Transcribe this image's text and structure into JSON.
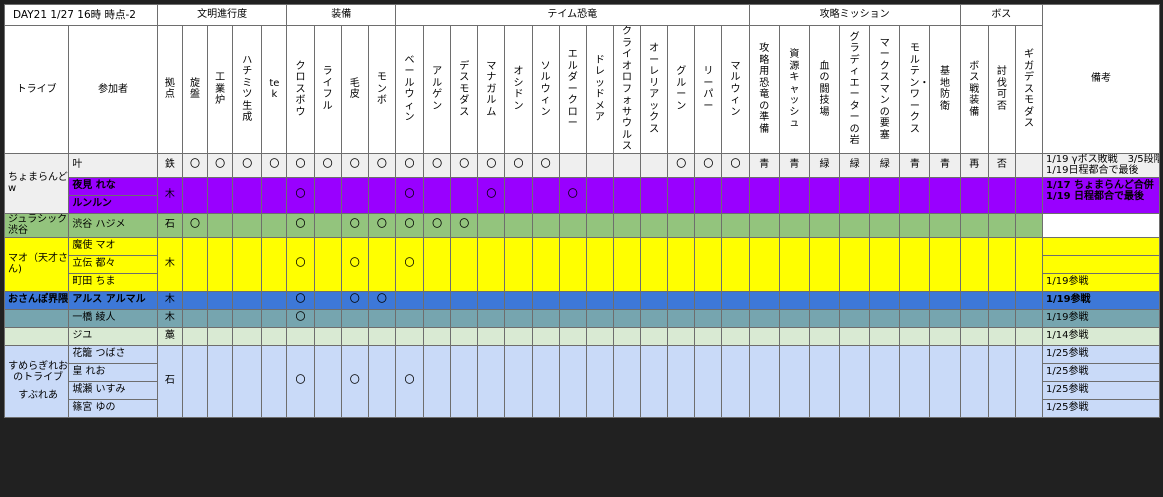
{
  "title": "DAY21 1/27 16時 時点-2",
  "groups": {
    "civ": "文明進行度",
    "equip": "装備",
    "dino": "テイム恐竜",
    "mission": "攻略ミッション",
    "boss": "ボス"
  },
  "headers": {
    "tribe": "トライブ",
    "member": "参加者",
    "note": "備考",
    "cols": [
      "拠点",
      "旋盤",
      "工業炉",
      "ハチミツ生成",
      "tek",
      "クロスボウ",
      "ライフル",
      "毛皮",
      "モンボ",
      "ベールウィン",
      "アルゲン",
      "デスモダス",
      "マナガルム",
      "オシドン",
      "ソルウィン",
      "エルダークロー",
      "ドレッドメア",
      "クライオロフォサウルス",
      "オーレリアックス",
      "グルーン",
      "リーパー",
      "マルウィン",
      "攻略用恐竜の準備",
      "資源キャッシュ",
      "血の闘技場",
      "グラディエーターの岩",
      "マークスマンの要塞",
      "モルテン・ワークス",
      "基地防衛",
      "ボス戦装備",
      "討伐可否",
      "ギガデスモダス"
    ]
  },
  "tribes": {
    "t1": "ちょまらんどw",
    "t2": "ジュラシック渋谷",
    "t3": "マオ（天才さん)",
    "t4": "おさんぽ界隈",
    "t5a": "すめらぎれおのトライブ",
    "t5b": "すぶれあ"
  },
  "rows": [
    {
      "name": "叶",
      "cells": [
        "鉄",
        "〇",
        "〇",
        "〇",
        "〇",
        "〇",
        "〇",
        "〇",
        "〇",
        "〇",
        "〇",
        "〇",
        "〇",
        "〇",
        "〇",
        "",
        "",
        "",
        "",
        "〇",
        "〇",
        "〇",
        "青",
        "青",
        "緑",
        "緑",
        "緑",
        "青",
        "青",
        "再",
        "否",
        ""
      ],
      "note": "1/19 γボス敗戦　3/5段階",
      "note2": "1/19日程都合で最後"
    },
    {
      "name": "夜見 れな",
      "cells": [
        "木",
        "",
        "",
        "",
        "",
        "〇",
        "",
        "",
        "",
        "〇",
        "",
        "",
        "〇",
        "",
        "",
        "〇",
        "",
        "",
        "",
        "",
        "",
        "",
        "",
        "",
        "",
        "",
        "",
        "",
        "",
        "",
        "",
        ""
      ],
      "note": "1/17 ちょまらんど合併",
      "note2": "1/19  日程都合で最後"
    },
    {
      "name": "ルンルン"
    },
    {
      "name": "渋谷 ハジメ",
      "cells": [
        "石",
        "〇",
        "",
        "",
        "",
        "〇",
        "",
        "〇",
        "〇",
        "〇",
        "〇",
        "〇",
        "",
        "",
        "",
        "",
        "",
        "",
        "",
        "",
        "",
        "",
        "",
        "",
        "",
        "",
        "",
        "",
        "",
        "",
        "",
        ""
      ],
      "note": ""
    },
    {
      "name": "魔使 マオ",
      "cells": [
        "木",
        "",
        "",
        "",
        "",
        "〇",
        "",
        "〇",
        "",
        "〇",
        "",
        "",
        "",
        "",
        "",
        "",
        "",
        "",
        "",
        "",
        "",
        "",
        "",
        "",
        "",
        "",
        "",
        "",
        "",
        "",
        "",
        ""
      ]
    },
    {
      "name": "立伝 都々"
    },
    {
      "name": "町田 ちま",
      "note": "1/19参戦"
    },
    {
      "name": "アルス アルマル",
      "cells": [
        "木",
        "",
        "",
        "",
        "",
        "〇",
        "",
        "〇",
        "〇",
        "",
        "",
        "",
        "",
        "",
        "",
        "",
        "",
        "",
        "",
        "",
        "",
        "",
        "",
        "",
        "",
        "",
        "",
        "",
        "",
        "",
        "",
        ""
      ],
      "note": "1/19参戦"
    },
    {
      "name": "一橋 綾人",
      "cells": [
        "木",
        "",
        "",
        "",
        "",
        "〇",
        "",
        "",
        "",
        "",
        "",
        "",
        "",
        "",
        "",
        "",
        "",
        "",
        "",
        "",
        "",
        "",
        "",
        "",
        "",
        "",
        "",
        "",
        "",
        "",
        "",
        ""
      ],
      "note": "1/19参戦"
    },
    {
      "name": "ジユ",
      "cells": [
        "藁",
        "",
        "",
        "",
        "",
        "",
        "",
        "",
        "",
        "",
        "",
        "",
        "",
        "",
        "",
        "",
        "",
        "",
        "",
        "",
        "",
        "",
        "",
        "",
        "",
        "",
        "",
        "",
        "",
        "",
        "",
        ""
      ],
      "note": "1/14参戦"
    },
    {
      "name": "花籠 つばさ",
      "note": "1/25参戦"
    },
    {
      "name": "皇 れお",
      "cells": [
        "石",
        "",
        "",
        "",
        "",
        "〇",
        "",
        "〇",
        "",
        "〇",
        "",
        "",
        "",
        "",
        "",
        "",
        "",
        "",
        "",
        "",
        "",
        "",
        "",
        "",
        "",
        "",
        "",
        "",
        "",
        "",
        "",
        ""
      ],
      "note": "1/25参戦"
    },
    {
      "name": "城瀬 いすみ",
      "note": "1/25参戦"
    },
    {
      "name": "篠宮 ゆの",
      "note": "1/25参戦"
    }
  ]
}
